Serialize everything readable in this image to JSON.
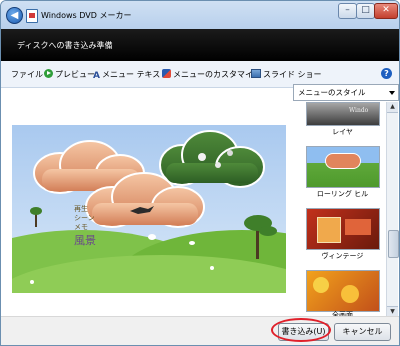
{
  "window": {
    "title": "Windows DVD メーカー",
    "header": "ディスクへの書き込み準備",
    "controls": {
      "minimize": "–",
      "maximize": "□",
      "close": "✕"
    }
  },
  "toolbar": {
    "file": "ファイル",
    "preview": "プレビュー",
    "menu_text": "メニュー テキスト",
    "customize": "メニューのカスタマイズ",
    "slideshow": "スライド ショー",
    "help": "?"
  },
  "style_panel": {
    "dropdown_label": "メニューのスタイル",
    "items": [
      {
        "label": "レイヤ"
      },
      {
        "label": "ローリング ヒル"
      },
      {
        "label": "ヴィンテージ"
      },
      {
        "label": "全画面"
      }
    ]
  },
  "preview": {
    "side_text": [
      "再生",
      "シーン",
      "メモ"
    ],
    "title_text": "風景"
  },
  "footer": {
    "burn_button": "書き込み(U)",
    "cancel_button": "キャンセル"
  },
  "colors": {
    "header_bg": "#000000",
    "highlight_ring": "#e0202a",
    "sky": "#b8d3f1",
    "grass": "#6fb63a"
  }
}
